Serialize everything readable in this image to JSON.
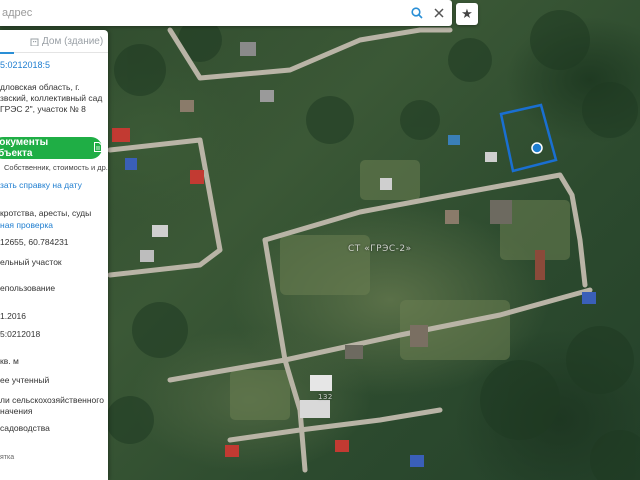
{
  "search": {
    "placeholder": "адрес",
    "fav_icon": "star-icon"
  },
  "panel": {
    "tabs": {
      "building_label": "Дом (здание)"
    },
    "cad_number": "5:0212018:5",
    "address_lines": [
      "дловская область, г.",
      "звский, коллективный сад",
      "ГРЭС 2\", участок № 8"
    ],
    "docs_button_label": "Документы объекта",
    "docs_subtitle": "Собственник, стоимость и др.",
    "order_link": "зать справку на дату",
    "checks_title": "кротства, аресты, суды",
    "checks_link": "ная проверка",
    "coords": "12655, 60.784231",
    "land_type": "ельный участок",
    "land_use": "епользование",
    "reg_date": "1.2016",
    "cad_number_2": "5:0212018",
    "area_unit": "кв. м",
    "status": "ее учтенный",
    "category_lines": [
      "ли сельскохозяйственного",
      "начения"
    ],
    "usage": "садоводства",
    "bottom_text": "ятка"
  },
  "map": {
    "labels": {
      "snt": "СТ «ГРЭС-2»",
      "house_num": "132"
    },
    "colors": {
      "selection": "#1a6fd1",
      "marker": "#1f7ed0",
      "road": "#b9b4a6"
    }
  }
}
